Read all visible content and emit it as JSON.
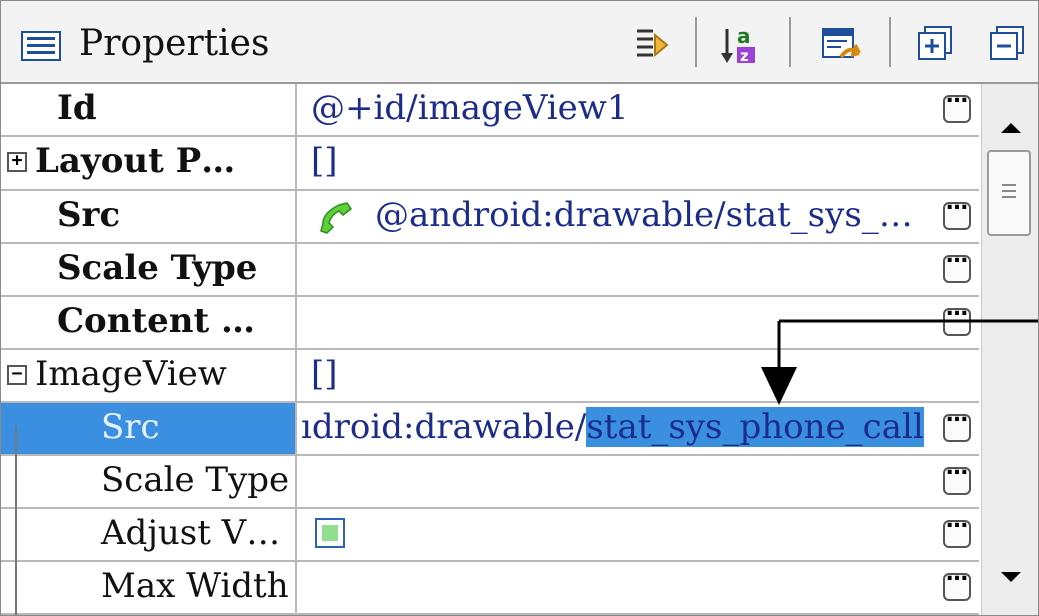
{
  "header": {
    "title": "Properties"
  },
  "toolbar": [
    {
      "name": "filter-icon"
    },
    {
      "name": "sort-az-icon",
      "label_top": "a",
      "label_bottom": "z"
    },
    {
      "name": "restore-default-icon"
    },
    {
      "name": "expand-all-icon"
    },
    {
      "name": "collapse-all-icon"
    }
  ],
  "rows": {
    "id": {
      "name": "Id",
      "value": "@+id/imageView1"
    },
    "layout": {
      "name": "Layout P…",
      "value": "[]"
    },
    "src": {
      "name": "Src",
      "value": "@android:drawable/stat_sys_…"
    },
    "scale_type": {
      "name": "Scale Type",
      "value": ""
    },
    "content": {
      "name": "Content …",
      "value": ""
    },
    "imageview": {
      "name": "ImageView",
      "value": "[]"
    },
    "iv_src": {
      "name": "Src",
      "value_plain": "ıdroid:drawable/",
      "value_selected": "stat_sys_phone_call"
    },
    "iv_scale_type": {
      "name": "Scale Type",
      "value": ""
    },
    "iv_adjust": {
      "name": "Adjust V…",
      "checked": true
    },
    "iv_max_width": {
      "name": "Max Width",
      "value": ""
    }
  },
  "colors": {
    "selection": "#3b8fe0",
    "value_text": "#1c2c8a",
    "phone_icon": "#5fcf3a"
  }
}
